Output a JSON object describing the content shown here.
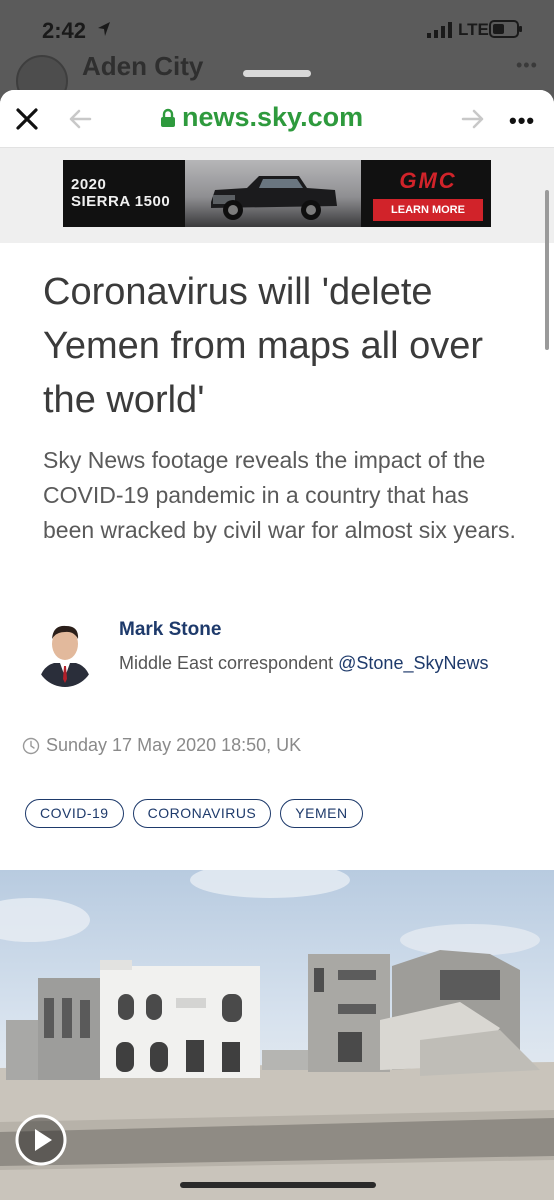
{
  "status": {
    "time": "2:42",
    "network": "LTE"
  },
  "background_app": {
    "title": "Aden City"
  },
  "browser": {
    "url": "news.sky.com"
  },
  "ad": {
    "model_line1": "2020",
    "model_line2": "SIERRA 1500",
    "brand": "GMC",
    "cta": "LEARN MORE"
  },
  "article": {
    "headline": "Coronavirus will 'delete Yemen from maps all over the world'",
    "standfirst": "Sky News footage reveals the impact of the COVID-19 pandemic in a country that has been wracked by civil war for almost six years.",
    "author": {
      "name": "Mark Stone",
      "role": "Middle East correspondent",
      "handle": "@Stone_SkyNews"
    },
    "date": "Sunday 17 May 2020 18:50, UK",
    "tags": [
      "COVID-19",
      "CORONAVIRUS",
      "YEMEN"
    ]
  },
  "colors": {
    "url_green": "#2e9a3d",
    "link_navy": "#1e3a6b",
    "gmc_red": "#d1232a"
  },
  "icons": [
    "location-arrow-icon",
    "signal-icon",
    "battery-icon",
    "close-icon",
    "back-arrow-icon",
    "lock-icon",
    "forward-arrow-icon",
    "more-icon",
    "clock-icon",
    "play-icon"
  ]
}
